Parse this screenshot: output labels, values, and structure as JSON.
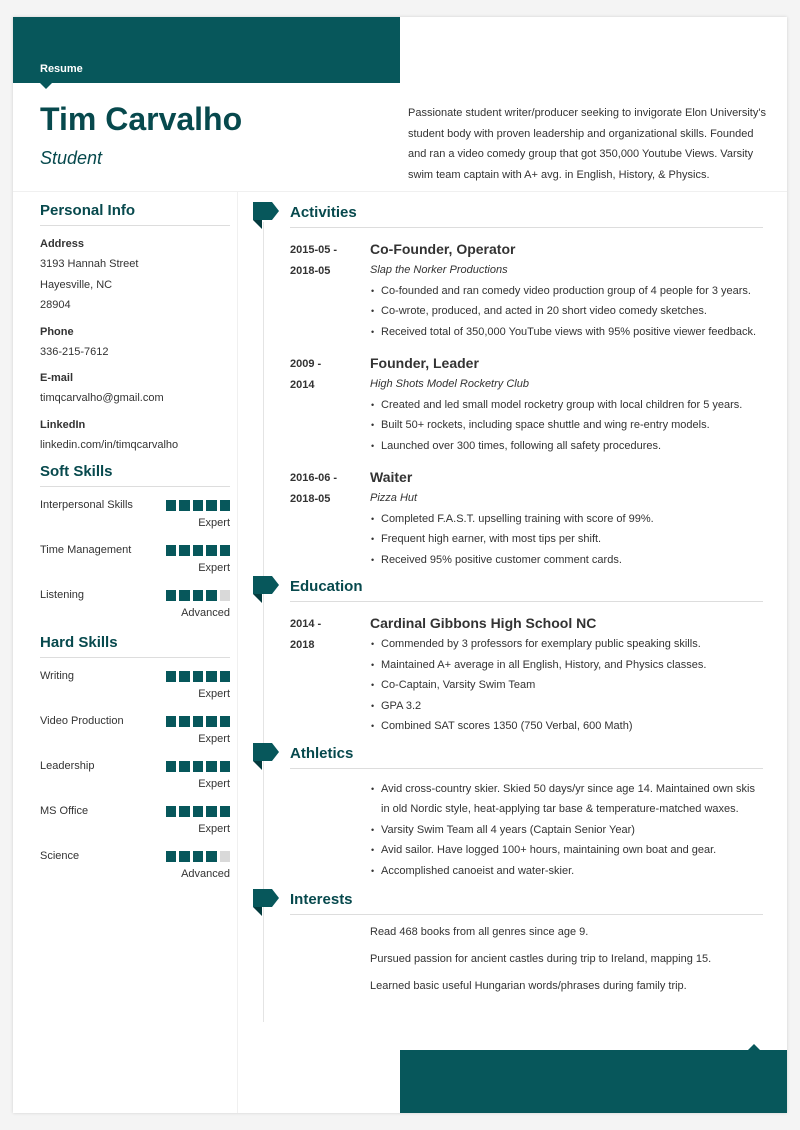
{
  "colors": {
    "accent": "#07575b",
    "heading": "#07494d",
    "dot_empty": "#d9d9d9"
  },
  "header": {
    "label": "Resume",
    "name": "Tim Carvalho",
    "role": "Student",
    "summary": "Passionate student writer/producer seeking to invigorate Elon University's student body with proven leadership and organizational skills. Founded and ran a video comedy group that got 350,000 Youtube Views. Varsity swim team captain with A+ avg. in English, History, & Physics."
  },
  "personal_info": {
    "title": "Personal Info",
    "address_label": "Address",
    "address_lines": [
      "3193 Hannah Street",
      "Hayesville, NC",
      "28904"
    ],
    "phone_label": "Phone",
    "phone": "336-215-7612",
    "email_label": "E-mail",
    "email": "timqcarvalho@gmail.com",
    "linkedin_label": "LinkedIn",
    "linkedin": "linkedin.com/in/timqcarvalho"
  },
  "soft_skills": {
    "title": "Soft Skills",
    "items": [
      {
        "name": "Interpersonal Skills",
        "rating": 5,
        "max": 5,
        "level": "Expert"
      },
      {
        "name": "Time Management",
        "rating": 5,
        "max": 5,
        "level": "Expert"
      },
      {
        "name": "Listening",
        "rating": 4,
        "max": 5,
        "level": "Advanced"
      }
    ]
  },
  "hard_skills": {
    "title": "Hard Skills",
    "items": [
      {
        "name": "Writing",
        "rating": 5,
        "max": 5,
        "level": "Expert"
      },
      {
        "name": "Video Production",
        "rating": 5,
        "max": 5,
        "level": "Expert"
      },
      {
        "name": "Leadership",
        "rating": 5,
        "max": 5,
        "level": "Expert"
      },
      {
        "name": "MS Office",
        "rating": 5,
        "max": 5,
        "level": "Expert"
      },
      {
        "name": "Science",
        "rating": 4,
        "max": 5,
        "level": "Advanced"
      }
    ]
  },
  "activities": {
    "title": "Activities",
    "entries": [
      {
        "date_start": "2015-05 -",
        "date_end": "2018-05",
        "title": "Co-Founder, Operator",
        "org": "Slap the Norker Productions",
        "bullets": [
          "Co-founded and ran comedy video production group of 4 people for 3 years.",
          "Co-wrote, produced, and acted in 20 short video comedy sketches.",
          "Received total of 350,000 YouTube views with 95% positive viewer feedback."
        ]
      },
      {
        "date_start": "2009 -",
        "date_end": "2014",
        "title": "Founder, Leader",
        "org": "High Shots Model Rocketry Club",
        "bullets": [
          "Created and led small model rocketry group with local children for 5 years.",
          "Built 50+ rockets, including space shuttle and wing re-entry models.",
          "Launched over 300 times, following all safety procedures."
        ]
      },
      {
        "date_start": "2016-06 -",
        "date_end": "2018-05",
        "title": "Waiter",
        "org": "Pizza Hut",
        "bullets": [
          "Completed F.A.S.T. upselling training with score of 99%.",
          "Frequent high earner, with most tips per shift.",
          "Received 95% positive customer comment cards."
        ]
      }
    ]
  },
  "education": {
    "title": "Education",
    "entries": [
      {
        "date_start": "2014 -",
        "date_end": "2018",
        "title": "Cardinal Gibbons High School NC",
        "bullets": [
          "Commended by 3 professors for exemplary public speaking skills.",
          "Maintained A+ average in all English, History, and Physics classes.",
          "Co-Captain, Varsity Swim Team",
          "GPA 3.2",
          "Combined SAT scores 1350 (750 Verbal, 600 Math)"
        ]
      }
    ]
  },
  "athletics": {
    "title": "Athletics",
    "bullets": [
      "Avid cross-country skier. Skied 50 days/yr since age 14. Maintained own skis in old Nordic style, heat-applying tar base & temperature-matched waxes.",
      "Varsity Swim Team all 4 years (Captain Senior Year)",
      "Avid sailor. Have logged 100+ hours, maintaining own boat and gear.",
      "Accomplished canoeist and water-skier."
    ]
  },
  "interests": {
    "title": "Interests",
    "items": [
      "Read 468 books from all genres since age 9.",
      "Pursued passion for ancient castles during trip to Ireland, mapping 15.",
      "Learned basic useful Hungarian words/phrases during family trip."
    ]
  }
}
